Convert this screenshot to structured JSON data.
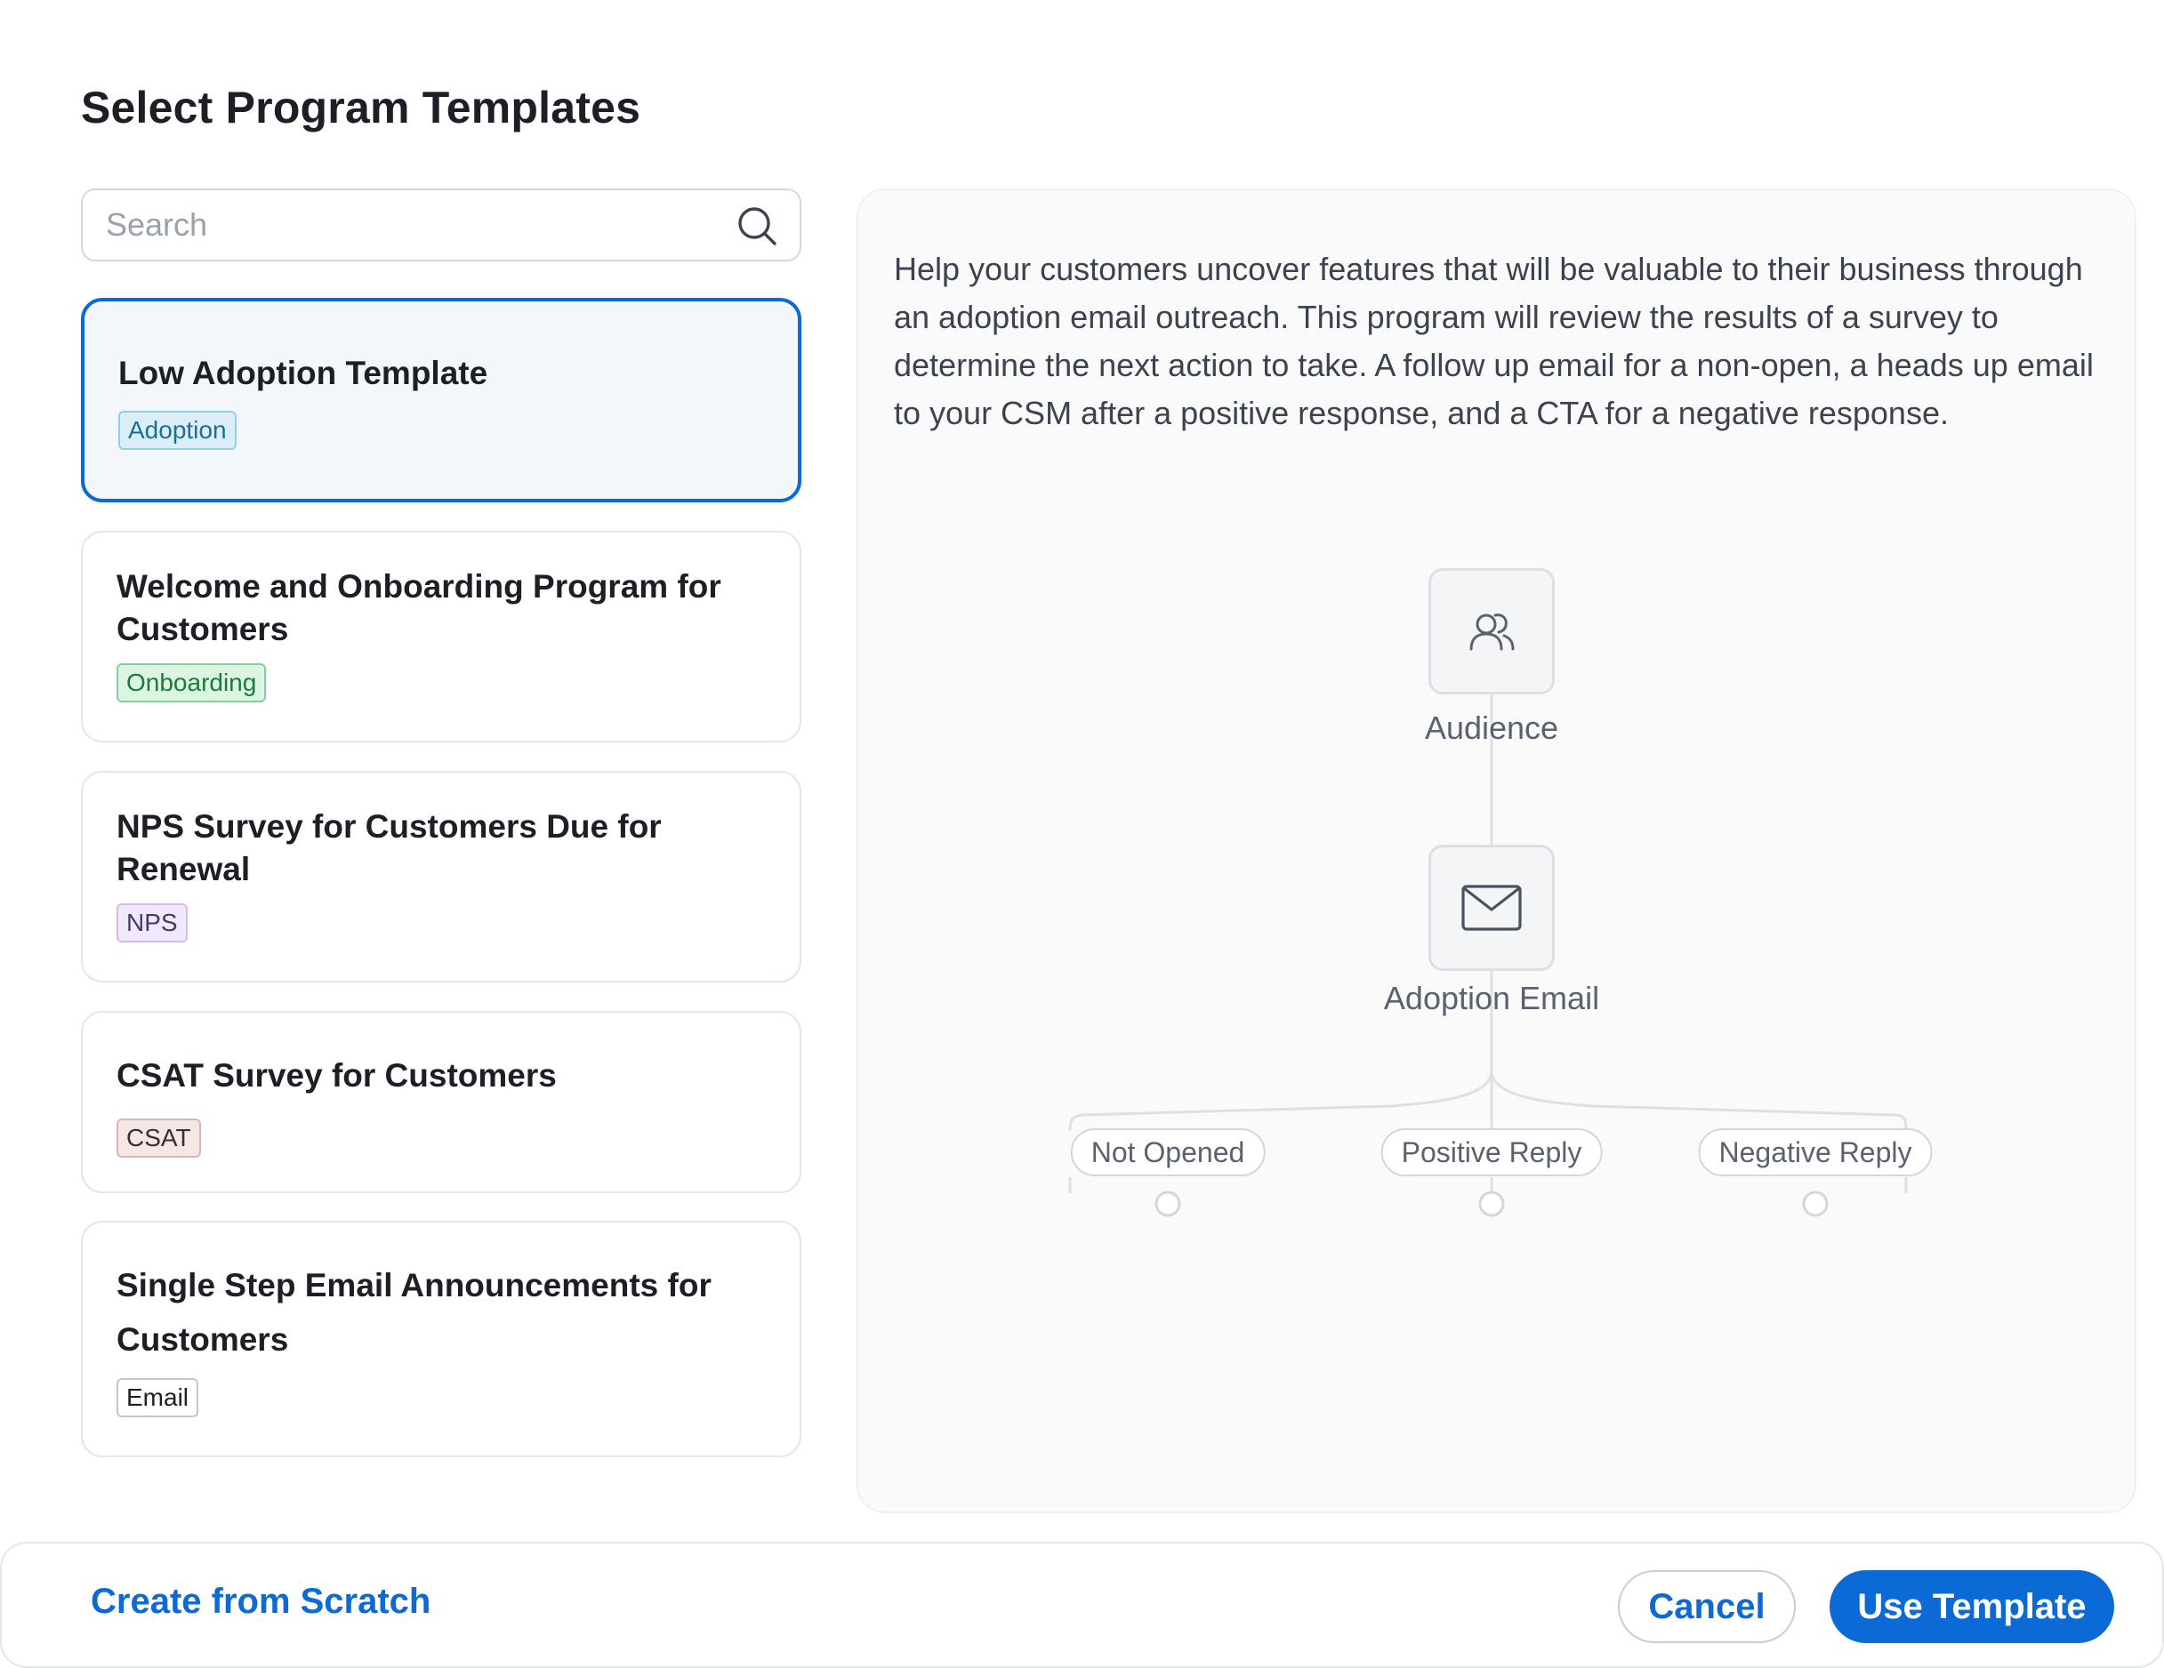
{
  "dialog": {
    "title": "Select Program Templates"
  },
  "search": {
    "placeholder": "Search",
    "value": ""
  },
  "templates": [
    {
      "title": "Low Adoption Template",
      "tag": "Adoption",
      "tag_color": "#1a6f93",
      "tag_bg": "#dbeef8",
      "tag_border": "#94cfe9",
      "selected": true
    },
    {
      "title": "Welcome and Onboarding Program for Customers",
      "tag": "Onboarding",
      "tag_color": "#1c7a3a",
      "tag_bg": "#dcf4e2",
      "tag_border": "#82d29b",
      "selected": false
    },
    {
      "title": "NPS Survey for Customers Due for Renewal",
      "tag": "NPS",
      "tag_color": "#4a3a63",
      "tag_bg": "#f2e8fb",
      "tag_border": "#d6b9f0",
      "selected": false
    },
    {
      "title": "CSAT Survey for Customers",
      "tag": "CSAT",
      "tag_color": "#3a2f2f",
      "tag_bg": "#f6e6e4",
      "tag_border": "#dbb6b1",
      "selected": false
    },
    {
      "title": "Single Step Email Announcements for Customers",
      "tag": "Email",
      "tag_color": "#1c1f26",
      "tag_bg": "#ffffff",
      "tag_border": "#c2c7ce",
      "selected": false
    }
  ],
  "preview": {
    "description": "Help your customers uncover features that will be valuable to their business through an adoption email outreach. This program will review the results of a survey to determine the next action to take. A follow up email for a non-open, a heads up email to your CSM after a positive response, and a CTA for a negative response.",
    "flow": {
      "steps": [
        {
          "label": "Audience",
          "icon": "users-icon"
        },
        {
          "label": "Adoption Email",
          "icon": "envelope-icon"
        }
      ],
      "branches": [
        "Not Opened",
        "Positive Reply",
        "Negative Reply"
      ]
    }
  },
  "footer": {
    "create_label": "Create from Scratch",
    "cancel_label": "Cancel",
    "use_label": "Use Template"
  },
  "colors": {
    "accent": "#0b6ad6",
    "card_border": "#e3e6ea",
    "selected_bg": "#f3f6fb"
  }
}
